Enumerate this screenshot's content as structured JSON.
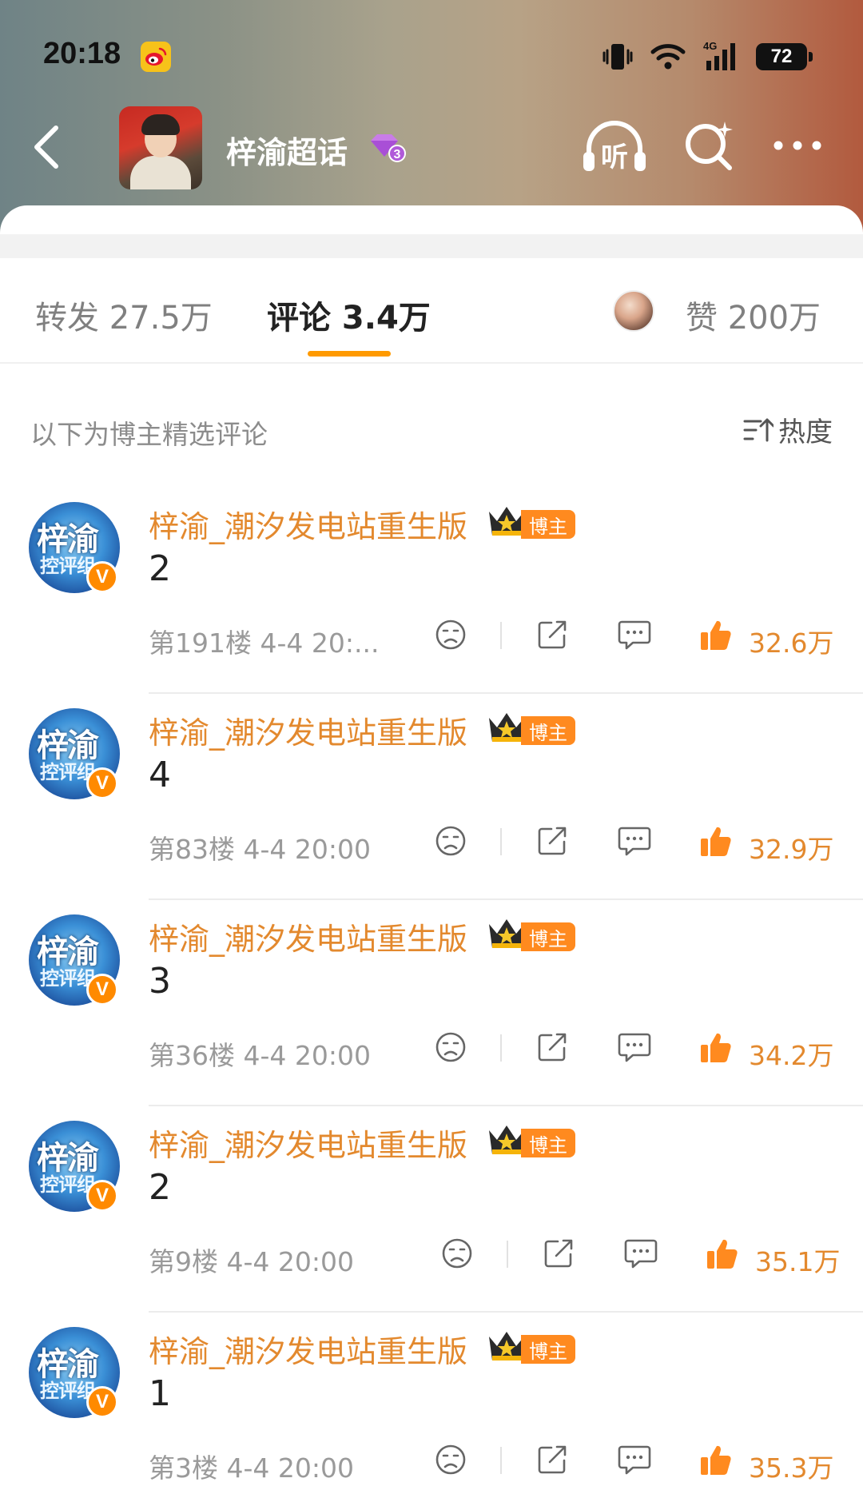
{
  "status_bar": {
    "time": "20:18",
    "network": "4G",
    "battery": "72"
  },
  "topic": {
    "title": "梓渝超话",
    "vip_level": "3"
  },
  "nav": {
    "listen_label": "听"
  },
  "tabs": {
    "repost": "转发 27.5万",
    "comment": "评论 3.4万",
    "like": "赞 200万"
  },
  "section": {
    "note": "以下为博主精选评论",
    "sort_label": "热度"
  },
  "comments": [
    {
      "author": "梓渝_潮汐发电站重生版",
      "badge": "博主",
      "avatar_text_1": "梓渝",
      "avatar_text_2": "控评组",
      "text": "2",
      "meta": "第191楼 4-4 20:...",
      "likes": "32.6万"
    },
    {
      "author": "梓渝_潮汐发电站重生版",
      "badge": "博主",
      "avatar_text_1": "梓渝",
      "avatar_text_2": "控评组",
      "text": "4",
      "meta": "第83楼 4-4 20:00",
      "likes": "32.9万"
    },
    {
      "author": "梓渝_潮汐发电站重生版",
      "badge": "博主",
      "avatar_text_1": "梓渝",
      "avatar_text_2": "控评组",
      "text": "3",
      "meta": "第36楼 4-4 20:00",
      "likes": "34.2万"
    },
    {
      "author": "梓渝_潮汐发电站重生版",
      "badge": "博主",
      "avatar_text_1": "梓渝",
      "avatar_text_2": "控评组",
      "text": "2",
      "meta": "第9楼 4-4 20:00",
      "likes": "35.1万"
    },
    {
      "author": "梓渝_潮汐发电站重生版",
      "badge": "博主",
      "avatar_text_1": "梓渝",
      "avatar_text_2": "控评组",
      "text": "1",
      "meta": "第3楼 4-4 20:00",
      "likes": "35.3万"
    }
  ],
  "icons": {
    "back": "back-arrow-icon",
    "listen": "headphones-icon",
    "search": "search-icon",
    "more": "more-dots-icon",
    "sort": "sort-icon",
    "dislike": "sad-face-icon",
    "share": "share-icon",
    "reply": "comment-bubble-icon",
    "like": "thumbs-up-icon"
  },
  "colors": {
    "accent": "#ff9a00",
    "author": "#e3892e",
    "badge": "#ff8a1f"
  }
}
